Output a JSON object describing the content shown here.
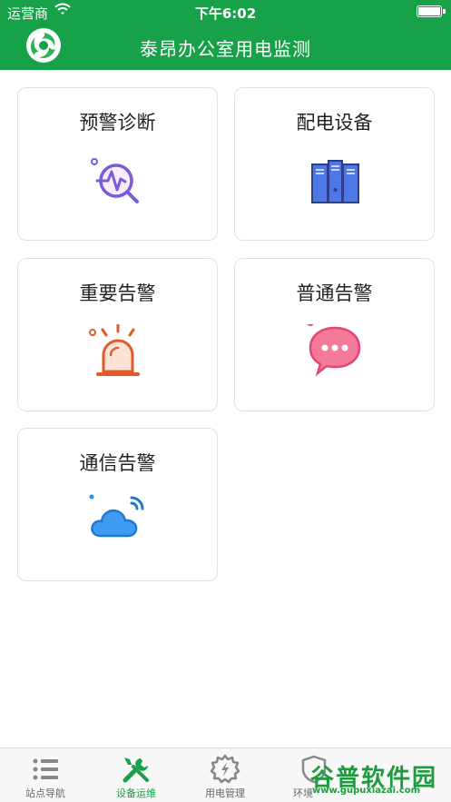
{
  "status_bar": {
    "carrier": "运营商",
    "time": "下午6:02"
  },
  "nav": {
    "title": "泰昂办公室用电监测"
  },
  "tiles": [
    {
      "label": "预警诊断",
      "icon": "warning-diagnosis-icon"
    },
    {
      "label": "配电设备",
      "icon": "distribution-equipment-icon"
    },
    {
      "label": "重要告警",
      "icon": "alarm-light-icon"
    },
    {
      "label": "普通告警",
      "icon": "chat-bubble-icon"
    },
    {
      "label": "通信告警",
      "icon": "cloud-signal-icon"
    }
  ],
  "tabs": [
    {
      "label": "站点导航",
      "icon": "list-icon",
      "active": false
    },
    {
      "label": "设备运维",
      "icon": "tools-icon",
      "active": true
    },
    {
      "label": "用电管理",
      "icon": "power-gear-icon",
      "active": false
    },
    {
      "label": "环境",
      "icon": "shield-icon",
      "active": false
    }
  ],
  "watermark": {
    "text": "谷普软件园",
    "url": "www.gupuxiazai.com"
  },
  "colors": {
    "brand": "#17a149",
    "tab_active": "#17a149"
  }
}
